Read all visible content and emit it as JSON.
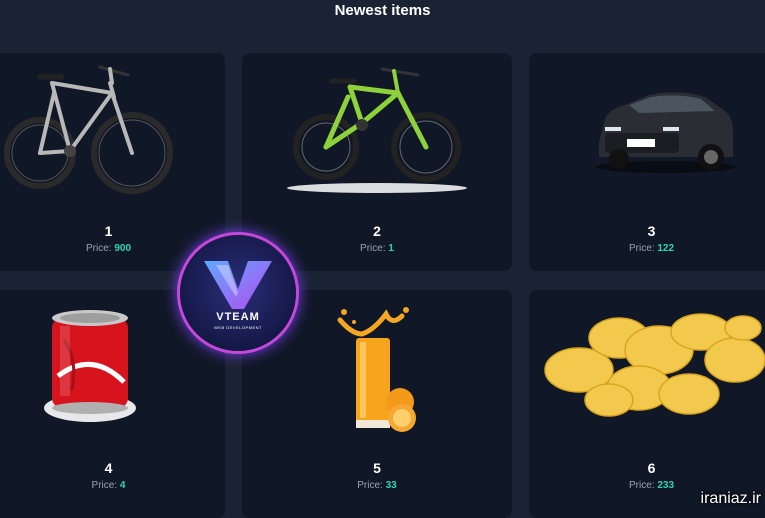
{
  "header": {
    "title": "Newest items"
  },
  "price_label": "Price:",
  "items": [
    {
      "title": "1",
      "price": "900",
      "image": "bicycle-gray"
    },
    {
      "title": "2",
      "price": "1",
      "image": "bicycle-green"
    },
    {
      "title": "3",
      "price": "122",
      "image": "car-black"
    },
    {
      "title": "4",
      "price": "4",
      "image": "soda-can"
    },
    {
      "title": "5",
      "price": "33",
      "image": "orange-juice"
    },
    {
      "title": "6",
      "price": "233",
      "image": "potato-chips"
    }
  ],
  "logo": {
    "word": "VTEAM",
    "sub": "WEB DEVELOPMENT"
  },
  "watermark": "iraniaz.ir",
  "colors": {
    "background": "#1a2333",
    "card": "#101827",
    "price_value": "#2fd4b3",
    "logo_ring": "#c548d8"
  }
}
